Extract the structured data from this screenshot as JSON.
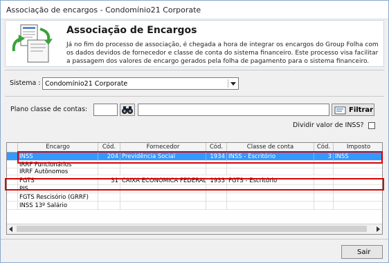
{
  "window": {
    "title": "Associação de encargos - Condomínio21 Corporate"
  },
  "header": {
    "icon": "documents-refresh-icon",
    "title": "Associação de Encargos",
    "description": "Já no fim do processo de associação, é chegada a hora de integrar os encargos do Group Folha com os dados devidos de fornecedor e classe de conta do sistema financeiro. Este processo visa facilitar a passagem dos valores de encargo gerados pela folha de pagamento para o sistema financeiro."
  },
  "sistema": {
    "label": "Sistema :",
    "value": "Condomínio21 Corporate"
  },
  "plano": {
    "label": "Plano classe de contas:",
    "code": "",
    "description": "",
    "search_icon": "binoculars-icon"
  },
  "filtrar": {
    "label": "Filtrar",
    "icon": "filter-icon"
  },
  "dividir": {
    "label": "Dividir valor de INSS?",
    "checked": false
  },
  "grid": {
    "columns": [
      "Encargo",
      "Cód.",
      "Fornecedor",
      "Cód.",
      "Classe de conta",
      "Cód.",
      "Imposto"
    ],
    "rows": [
      [
        "INSS",
        "204",
        "Previdência Social",
        "1934",
        "INSS - Escritório",
        "3",
        "INSS"
      ],
      [
        "IRRF Funcionários",
        "",
        "",
        "",
        "",
        "",
        ""
      ],
      [
        "IRRF Autônomos",
        "",
        "",
        "",
        "",
        "",
        ""
      ],
      [
        "FGTS",
        "31",
        "CAIXA ECONOMICA FEDERAL",
        "1933",
        "FGTS - Escritório",
        "",
        ""
      ],
      [
        "PIS",
        "",
        "",
        "",
        "",
        "",
        ""
      ],
      [
        "FGTS Rescisório (GRRF)",
        "",
        "",
        "",
        "",
        "",
        ""
      ],
      [
        "INSS 13º Salário",
        "",
        "",
        "",
        "",
        "",
        ""
      ]
    ],
    "selected_row": 0,
    "highlighted_rows": [
      0,
      3
    ],
    "highlight_color": "#d40000",
    "selection_color": "#3399ff"
  },
  "footer": {
    "sair_label": "Sair"
  }
}
